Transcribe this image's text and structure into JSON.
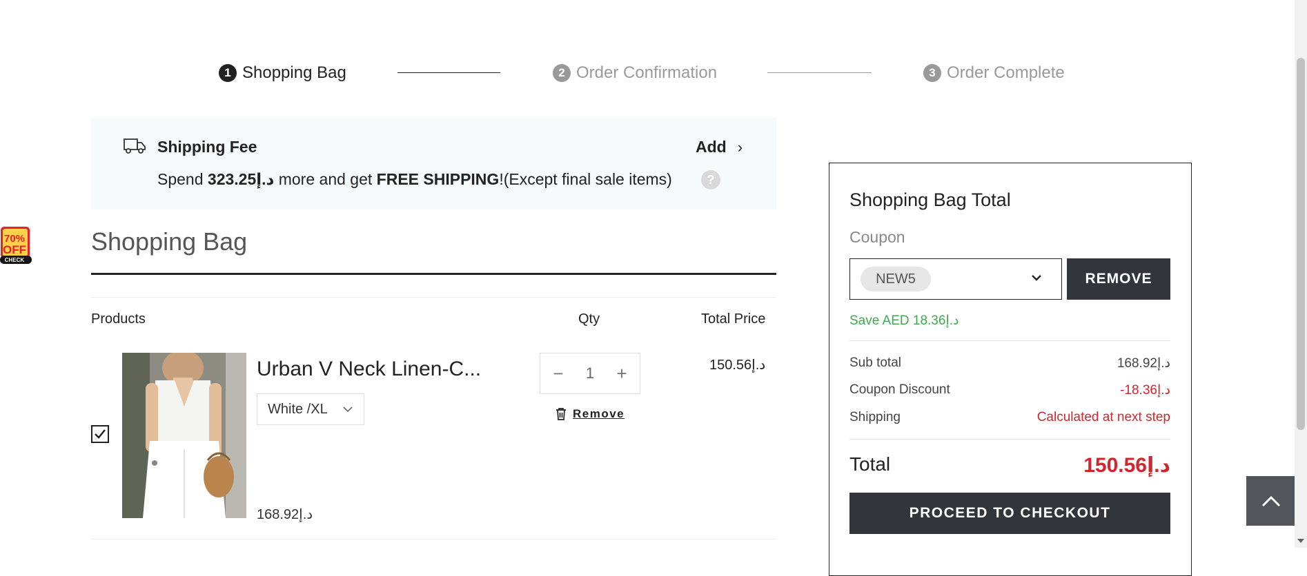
{
  "stepper": {
    "steps": [
      {
        "num": "1",
        "label": "Shopping Bag"
      },
      {
        "num": "2",
        "label": "Order Confirmation"
      },
      {
        "num": "3",
        "label": "Order Complete"
      }
    ]
  },
  "shipping_banner": {
    "title": "Shipping Fee",
    "add_label": "Add",
    "text_prefix": "Spend ",
    "amount": "323.25د.إ",
    "text_middle": " more and get ",
    "free_label": "FREE SHIPPING",
    "text_suffix": "!(Except final sale items)",
    "help": "?"
  },
  "side_badge": {
    "line1": "70%",
    "line2": "OFF",
    "line3": "CHECK"
  },
  "bag": {
    "title": "Shopping Bag",
    "columns": {
      "products": "Products",
      "qty": "Qty",
      "total": "Total Price"
    },
    "items": [
      {
        "name": "Urban V Neck Linen-C...",
        "variant": "White /XL",
        "original_price": "168.92د.إ",
        "qty": "1",
        "line_total": "150.56د.إ",
        "checked": true,
        "remove_label": "Remove"
      }
    ]
  },
  "summary": {
    "title": "Shopping Bag Total",
    "coupon_label": "Coupon",
    "coupon_code": "NEW5",
    "remove_label": "REMOVE",
    "save_text": "Save AED 18.36د.إ",
    "rows": [
      {
        "label": "Sub total",
        "value": "168.92د.إ"
      },
      {
        "label": "Coupon Discount",
        "value": "-18.36د.إ"
      },
      {
        "label": "Shipping",
        "value": "Calculated at next step"
      }
    ],
    "total_label": "Total",
    "total_value": "150.56د.إ",
    "checkout_label": "PROCEED TO CHECKOUT"
  },
  "colors": {
    "accent_dark": "#32353b",
    "save_green": "#3cab4b",
    "alert_red": "#d0262f",
    "banner_bg": "#f4fbfa"
  }
}
